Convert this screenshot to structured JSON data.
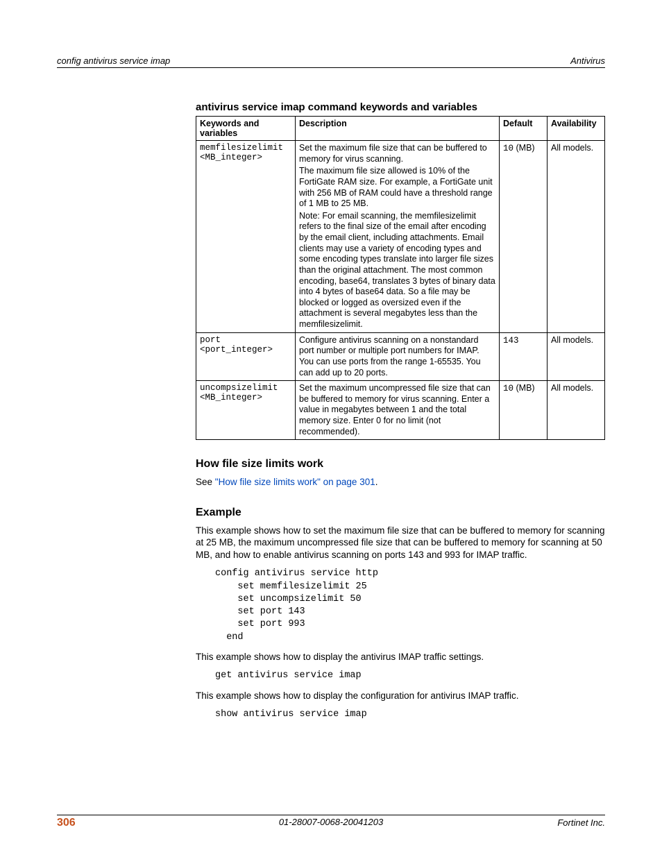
{
  "header": {
    "left": "config antivirus service imap",
    "right": "Antivirus"
  },
  "table": {
    "title": "antivirus service imap command keywords and variables",
    "headers": {
      "keywords": "Keywords and variables",
      "description": "Description",
      "default": "Default",
      "availability": "Availability"
    },
    "rows": [
      {
        "keyword": "memfilesizelimit <MB_integer>",
        "desc_p1": "Set the maximum file size that can be buffered to memory for virus scanning.",
        "desc_p2": "The maximum file size allowed is 10% of the FortiGate RAM size. For example, a FortiGate unit with 256 MB of RAM could have a threshold range of 1 MB to 25 MB.",
        "desc_p3": "Note: For email scanning, the memfilesizelimit refers to the final size of the email after encoding by the email client, including attachments. Email clients may use a variety of encoding types and some encoding types translate into larger file sizes than the original attachment. The most common encoding, base64, translates 3 bytes of binary data into 4 bytes of base64 data. So a file may be blocked or logged as oversized even if the attachment is several megabytes less than the memfilesizelimit.",
        "default_mono": "10",
        "default_suffix": " (MB)",
        "availability": "All models."
      },
      {
        "keyword": "port\n<port_integer>",
        "desc_p1": "Configure antivirus scanning on a nonstandard port number or multiple port numbers for IMAP. You can use ports from the range 1-65535. You can add up to 20 ports.",
        "default_mono": "143",
        "default_suffix": "",
        "availability": "All models."
      },
      {
        "keyword": "uncompsizelimit\n<MB_integer>",
        "desc_p1": "Set the maximum uncompressed file size that can be buffered to memory for virus scanning. Enter a value in megabytes between 1 and the total memory size. Enter 0 for no limit (not recommended).",
        "default_mono": "10",
        "default_suffix": " (MB)",
        "availability": "All models."
      }
    ]
  },
  "sections": {
    "how_title": "How file size limits work",
    "how_see": "See ",
    "how_link": "\"How file size limits work\" on page 301",
    "how_period": ".",
    "example_title": "Example",
    "example_intro": "This example shows how to set the maximum file size that can be buffered to memory for scanning at 25 MB, the maximum uncompressed file size that can be buffered to memory for scanning at 50 MB, and how to enable antivirus scanning on ports 143 and 993 for IMAP traffic.",
    "code1": "config antivirus service http\n    set memfilesizelimit 25\n    set uncompsizelimit 50\n    set port 143\n    set port 993\n  end",
    "example_mid1": "This example shows how to display the antivirus IMAP traffic settings.",
    "code2": "get antivirus service imap",
    "example_mid2": "This example shows how to display the configuration for antivirus IMAP traffic.",
    "code3": "show antivirus service imap"
  },
  "footer": {
    "page": "306",
    "mid": "01-28007-0068-20041203",
    "right": "Fortinet Inc."
  }
}
